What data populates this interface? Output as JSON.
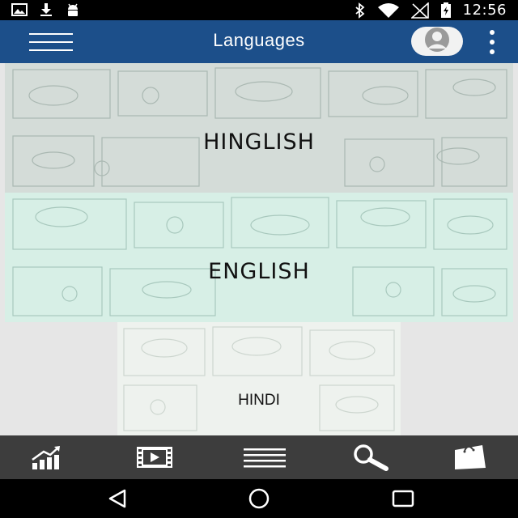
{
  "status_bar": {
    "time": "12:56",
    "left_icons": [
      "image-icon",
      "download-icon",
      "android-icon"
    ],
    "right_icons": [
      "bluetooth-icon",
      "wifi-icon",
      "signal-icon",
      "battery-charging-icon"
    ]
  },
  "app_bar": {
    "title": "Languages",
    "color": "#1c4f8a",
    "icons": [
      "menu-icon",
      "avatar-icon",
      "more-vert-icon"
    ]
  },
  "languages": [
    {
      "label": "HINGLISH"
    },
    {
      "label": "ENGLISH"
    },
    {
      "label": "HINDI"
    }
  ],
  "bottom_bar": {
    "icons": [
      "trending-chart-icon",
      "film-icon",
      "list-icon",
      "search-icon",
      "shopping-bag-icon"
    ]
  },
  "nav_bar": {
    "icons": [
      "back-icon",
      "home-icon",
      "recents-icon"
    ]
  }
}
